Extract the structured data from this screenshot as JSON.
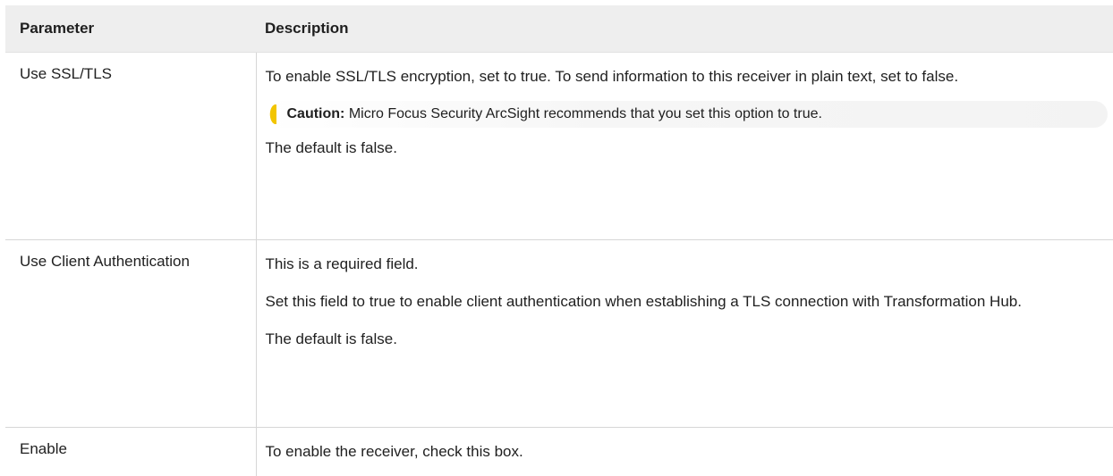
{
  "table": {
    "headers": [
      "Parameter",
      "Description"
    ],
    "rows": [
      {
        "parameter": "Use SSL/TLS",
        "p1": "To enable SSL/TLS encryption, set to true. To send information to this receiver in plain text, set to false.",
        "caution_label": "Caution:",
        "caution_text": " Micro Focus Security ArcSight recommends that you set this option to true.",
        "p2": "The default is false."
      },
      {
        "parameter": "Use Client Authentication",
        "p1": "This is a required field.",
        "p2": "Set this field to true to enable client authentication when establishing a TLS connection with Transformation Hub.",
        "p3": "The default is false."
      },
      {
        "parameter": "Enable",
        "p1": "To enable the receiver, check this box."
      }
    ]
  },
  "colors": {
    "header_bg": "#eeeeee",
    "caution_accent": "#f2c500",
    "border": "#d6d6d6"
  },
  "icons": {
    "caution": "caution-bracket-icon"
  }
}
